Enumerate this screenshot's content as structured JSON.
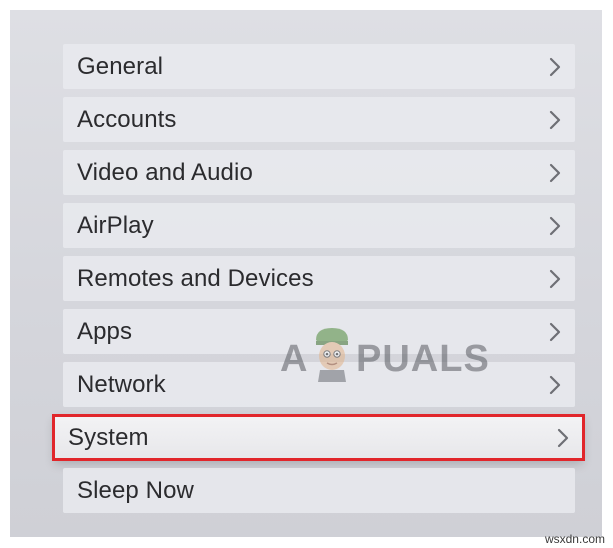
{
  "settings_menu": {
    "items": [
      {
        "label": "General"
      },
      {
        "label": "Accounts"
      },
      {
        "label": "Video and Audio"
      },
      {
        "label": "AirPlay"
      },
      {
        "label": "Remotes and Devices"
      },
      {
        "label": "Apps"
      },
      {
        "label": "Network"
      },
      {
        "label": "System",
        "focused": true
      },
      {
        "label": "Sleep Now"
      }
    ]
  },
  "watermark": {
    "left_text": "A",
    "right_text": "PUALS"
  },
  "credit": "wsxdn.com",
  "colors": {
    "highlight_border": "#e1262b",
    "item_background": "#e9eaee",
    "screen_background": "#d8d9de"
  }
}
